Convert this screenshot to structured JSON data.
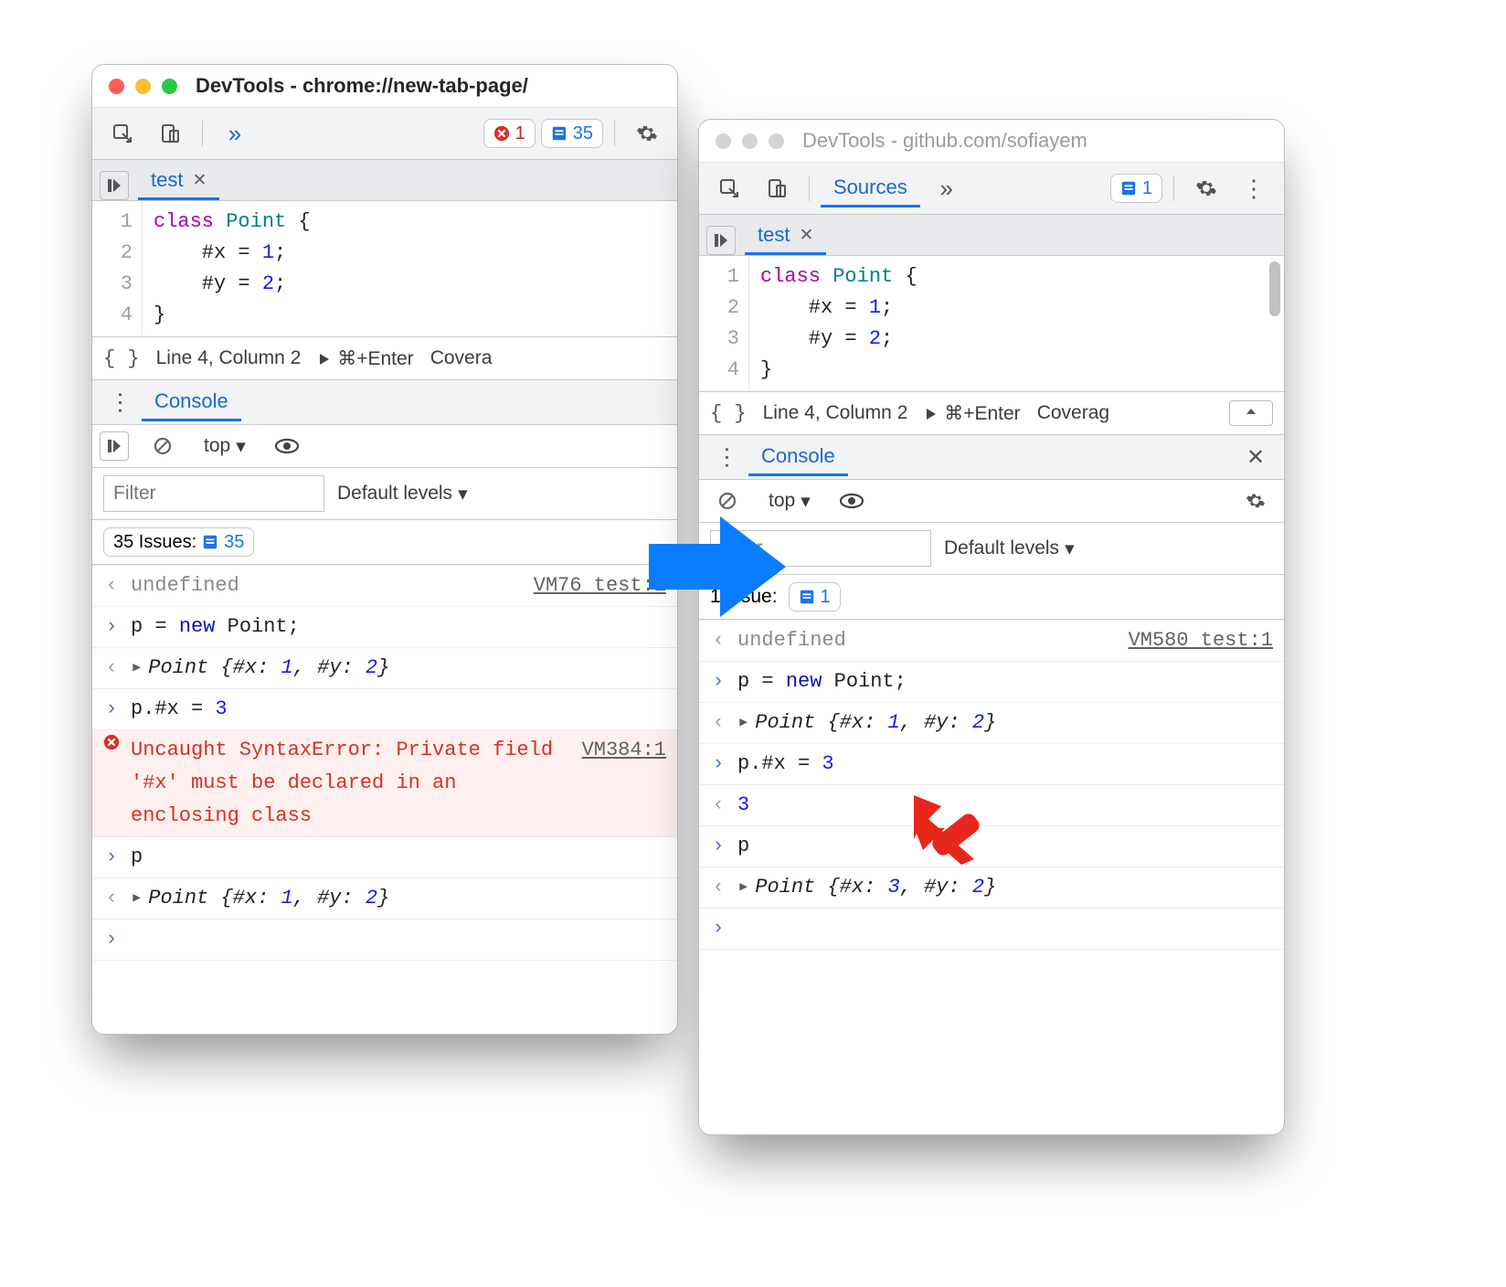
{
  "left": {
    "title": "DevTools - chrome://new-tab-page/",
    "toolbar": {
      "errors": "1",
      "issues": "35"
    },
    "sources": {
      "tab": "test",
      "lines": [
        "1",
        "2",
        "3",
        "4"
      ],
      "code": [
        {
          "t": "class ",
          "c": "kw"
        },
        {
          "t": "Point ",
          "c": "type"
        },
        {
          "t": "{\n"
        },
        {
          "t": "    #x = "
        },
        {
          "t": "1",
          "c": "num"
        },
        {
          "t": ";\n"
        },
        {
          "t": "    #y = "
        },
        {
          "t": "2",
          "c": "num"
        },
        {
          "t": ";\n"
        },
        {
          "t": "}"
        }
      ],
      "linecol": "Line 4, Column 2",
      "run_hint": "⌘+Enter",
      "coverage": "Covera"
    },
    "drawer": {
      "console": "Console"
    },
    "consoleToolbar": {
      "context": "top",
      "filter_placeholder": "Filter",
      "levels": "Default levels"
    },
    "issuesRow": {
      "label": "35 Issues:",
      "count": "35"
    },
    "log": [
      {
        "kind": "out",
        "text": "undefined",
        "src": "VM76 test:1",
        "muted": true
      },
      {
        "kind": "in",
        "segments": [
          {
            "t": "p = "
          },
          {
            "t": "new ",
            "c": "navy"
          },
          {
            "t": "Point;"
          }
        ]
      },
      {
        "kind": "out",
        "segments": [
          {
            "t": "Point {#x: ",
            "it": true
          },
          {
            "t": "1",
            "c": "num",
            "it": true
          },
          {
            "t": ", #y: ",
            "it": true
          },
          {
            "t": "2",
            "c": "num",
            "it": true
          },
          {
            "t": "}",
            "it": true
          }
        ],
        "expander": true
      },
      {
        "kind": "in",
        "segments": [
          {
            "t": "p.#x = "
          },
          {
            "t": "3",
            "c": "num"
          }
        ]
      },
      {
        "kind": "err",
        "text": "Uncaught SyntaxError: Private field '#x' must be declared in an enclosing class",
        "src": "VM384:1"
      },
      {
        "kind": "in",
        "segments": [
          {
            "t": "p"
          }
        ]
      },
      {
        "kind": "out",
        "segments": [
          {
            "t": "Point {#x: ",
            "it": true
          },
          {
            "t": "1",
            "c": "num",
            "it": true
          },
          {
            "t": ", #y: ",
            "it": true
          },
          {
            "t": "2",
            "c": "num",
            "it": true
          },
          {
            "t": "}",
            "it": true
          }
        ],
        "expander": true
      },
      {
        "kind": "prompt"
      }
    ]
  },
  "right": {
    "title": "DevTools - github.com/sofiayem",
    "toolbar": {
      "sources_tab": "Sources",
      "issues": "1"
    },
    "sources": {
      "tab": "test",
      "lines": [
        "1",
        "2",
        "3",
        "4"
      ],
      "code": [
        {
          "t": "class ",
          "c": "kw"
        },
        {
          "t": "Point ",
          "c": "type"
        },
        {
          "t": "{\n"
        },
        {
          "t": "    #x = "
        },
        {
          "t": "1",
          "c": "num"
        },
        {
          "t": ";\n"
        },
        {
          "t": "    #y = "
        },
        {
          "t": "2",
          "c": "num"
        },
        {
          "t": ";\n"
        },
        {
          "t": "}"
        }
      ],
      "linecol": "Line 4, Column 2",
      "run_hint": "⌘+Enter",
      "coverage": "Coverag"
    },
    "drawer": {
      "console": "Console"
    },
    "consoleToolbar": {
      "context": "top",
      "filter_placeholder": "Filter",
      "levels": "Default levels"
    },
    "issuesRow": {
      "label": "1 Issue:",
      "count": "1"
    },
    "log": [
      {
        "kind": "out",
        "text": "undefined",
        "src": "VM580 test:1",
        "muted": true
      },
      {
        "kind": "in",
        "segments": [
          {
            "t": "p = "
          },
          {
            "t": "new ",
            "c": "navy"
          },
          {
            "t": "Point;"
          }
        ]
      },
      {
        "kind": "out",
        "segments": [
          {
            "t": "Point {#x: ",
            "it": true
          },
          {
            "t": "1",
            "c": "num",
            "it": true
          },
          {
            "t": ", #y: ",
            "it": true
          },
          {
            "t": "2",
            "c": "num",
            "it": true
          },
          {
            "t": "}",
            "it": true
          }
        ],
        "expander": true
      },
      {
        "kind": "in",
        "segments": [
          {
            "t": "p.#x = "
          },
          {
            "t": "3",
            "c": "num"
          }
        ]
      },
      {
        "kind": "out",
        "segments": [
          {
            "t": "3",
            "c": "num"
          }
        ]
      },
      {
        "kind": "in",
        "segments": [
          {
            "t": "p"
          }
        ]
      },
      {
        "kind": "out",
        "segments": [
          {
            "t": "Point {#x: ",
            "it": true
          },
          {
            "t": "3",
            "c": "num",
            "it": true
          },
          {
            "t": ", #y: ",
            "it": true
          },
          {
            "t": "2",
            "c": "num",
            "it": true
          },
          {
            "t": "}",
            "it": true
          }
        ],
        "expander": true
      },
      {
        "kind": "prompt"
      }
    ]
  }
}
